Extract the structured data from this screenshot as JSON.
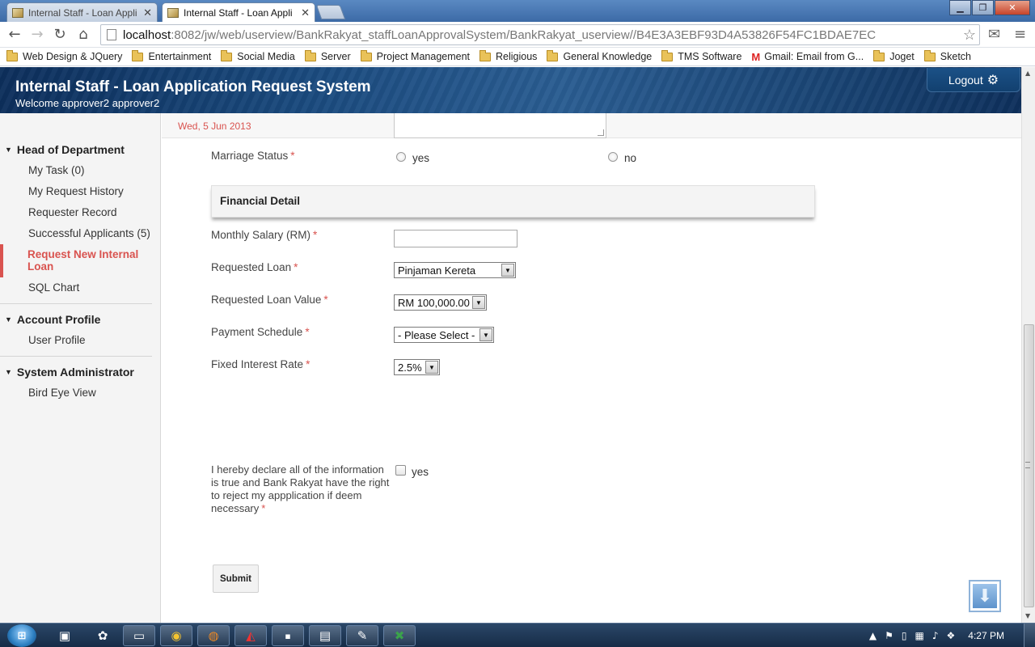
{
  "browser": {
    "tabs": [
      {
        "title": "Internal Staff - Loan Appli",
        "active": false
      },
      {
        "title": "Internal Staff - Loan Appli",
        "active": true
      }
    ],
    "url_host": "localhost",
    "url_path": ":8082/jw/web/userview/BankRakyat_staffLoanApprovalSystem/BankRakyat_userview//B4E3A3EBF93D4A53826F54FC1BDAE7EC",
    "bookmarks": [
      {
        "label": "Web Design & JQuery",
        "icon": "folder-icon"
      },
      {
        "label": "Entertainment",
        "icon": "folder-icon"
      },
      {
        "label": "Social Media",
        "icon": "folder-icon"
      },
      {
        "label": "Server",
        "icon": "folder-icon"
      },
      {
        "label": "Project Management",
        "icon": "folder-icon"
      },
      {
        "label": "Religious",
        "icon": "folder-icon"
      },
      {
        "label": "General Knowledge",
        "icon": "folder-icon"
      },
      {
        "label": "TMS Software",
        "icon": "folder-icon"
      },
      {
        "label": "Gmail: Email from G...",
        "icon": "gmail-icon"
      },
      {
        "label": "Joget",
        "icon": "folder-icon"
      },
      {
        "label": "Sketch",
        "icon": "folder-icon"
      }
    ]
  },
  "header": {
    "title": "Internal Staff - Loan Application Request System",
    "welcome": "Welcome approver2 approver2",
    "logout_label": "Logout"
  },
  "sidebar": {
    "sections": [
      {
        "title": "Head of Department",
        "items": [
          {
            "label": "My Task (0)",
            "active": false
          },
          {
            "label": "My Request History",
            "active": false
          },
          {
            "label": "Requester Record",
            "active": false
          },
          {
            "label": "Successful Applicants (5)",
            "active": false
          },
          {
            "label": "Request New Internal Loan",
            "active": true
          },
          {
            "label": "SQL Chart",
            "active": false
          }
        ]
      },
      {
        "title": "Account Profile",
        "items": [
          {
            "label": "User Profile",
            "active": false
          }
        ]
      },
      {
        "title": "System Administrator",
        "items": [
          {
            "label": "Bird Eye View",
            "active": false
          }
        ]
      }
    ]
  },
  "form": {
    "date": "Wed, 5 Jun 2013",
    "marriage_status": {
      "label": "Marriage Status",
      "options": [
        "yes",
        "no"
      ]
    },
    "financial_heading": "Financial Detail",
    "monthly_salary": {
      "label": "Monthly Salary (RM)",
      "value": ""
    },
    "requested_loan": {
      "label": "Requested Loan",
      "value": "Pinjaman Kereta"
    },
    "requested_loan_value": {
      "label": "Requested Loan Value",
      "value": "RM 100,000.00"
    },
    "payment_schedule": {
      "label": "Payment Schedule",
      "value": "- Please Select -"
    },
    "fixed_interest_rate": {
      "label": "Fixed Interest Rate",
      "value": "2.5%"
    },
    "declaration": {
      "label": "I hereby declare all of the information is true and Bank Rakyat have the right to reject my appplication if deem necessary",
      "option": "yes"
    },
    "submit_label": "Submit",
    "required_mark": "*"
  },
  "taskbar": {
    "clock": "4:27 PM"
  },
  "colors": {
    "accent_red": "#d9534f",
    "header_blue": "#1a4a7e"
  }
}
